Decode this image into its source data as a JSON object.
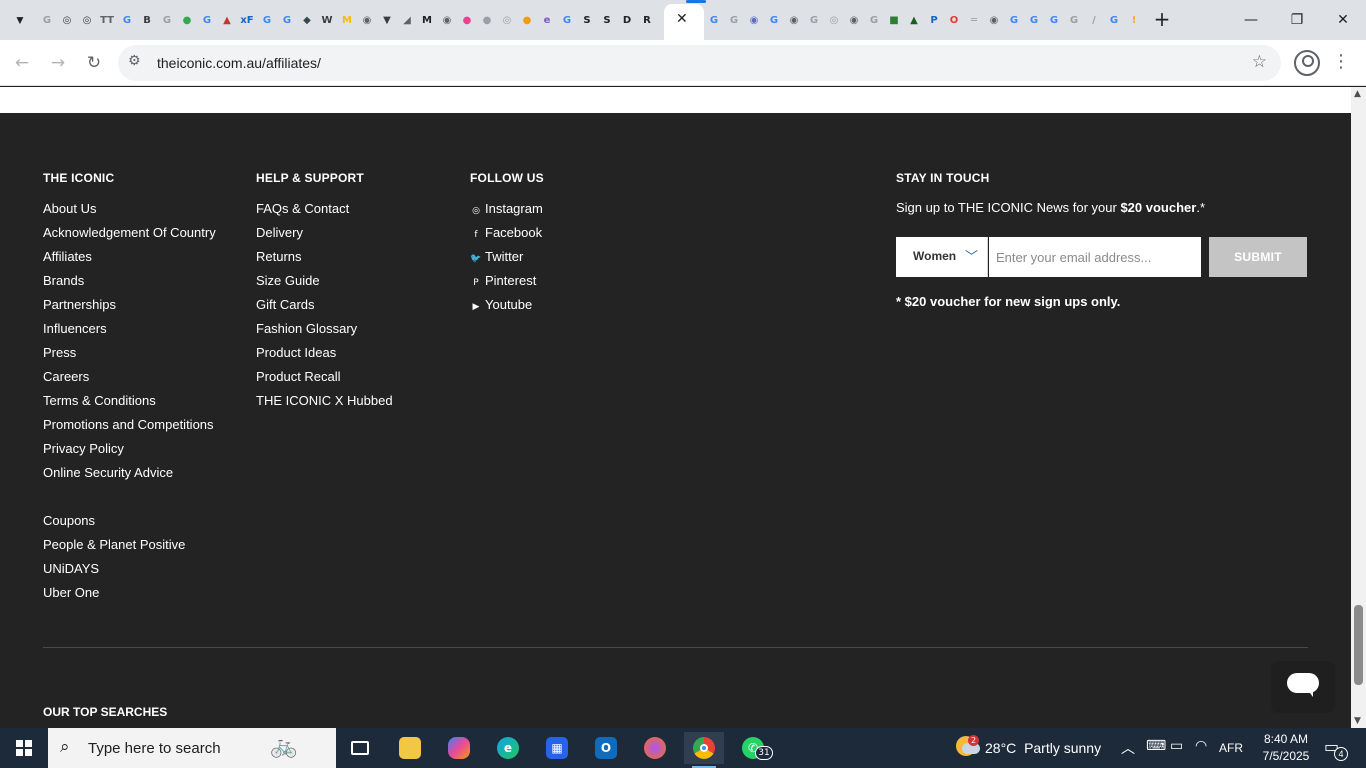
{
  "browser": {
    "url": "theiconic.com.au/affiliates/",
    "active_tab_close": "✕",
    "new_tab": "+",
    "tab_favicons": [
      {
        "glyph": "G",
        "color": "#9aa0a6"
      },
      {
        "glyph": "◎",
        "color": "#3c3c3c"
      },
      {
        "glyph": "◎",
        "color": "#3c3c3c"
      },
      {
        "glyph": "TT",
        "color": "#5f6368"
      },
      {
        "glyph": "G",
        "color": "#4285f4"
      },
      {
        "glyph": "B",
        "color": "#3c3c3c"
      },
      {
        "glyph": "G",
        "color": "#9aa0a6"
      },
      {
        "glyph": "●",
        "color": "#34a853"
      },
      {
        "glyph": "G",
        "color": "#4285f4"
      },
      {
        "glyph": "▲",
        "color": "#c0392b"
      },
      {
        "glyph": "xF",
        "color": "#1565c0"
      },
      {
        "glyph": "G",
        "color": "#4285f4"
      },
      {
        "glyph": "G",
        "color": "#4285f4"
      },
      {
        "glyph": "◆",
        "color": "#37474f"
      },
      {
        "glyph": "W",
        "color": "#3c3c3c"
      },
      {
        "glyph": "M",
        "color": "#fbbc04"
      },
      {
        "glyph": "◉",
        "color": "#5f6368"
      },
      {
        "glyph": "▼",
        "color": "#3c3c3c"
      },
      {
        "glyph": "◢",
        "color": "#5f6368"
      },
      {
        "glyph": "M",
        "color": "#202124"
      },
      {
        "glyph": "◉",
        "color": "#5f6368"
      },
      {
        "glyph": "●",
        "color": "#e84393"
      },
      {
        "glyph": "●",
        "color": "#9aa0a6"
      },
      {
        "glyph": "◎",
        "color": "#9aa0a6"
      },
      {
        "glyph": "●",
        "color": "#f39c12"
      },
      {
        "glyph": "e",
        "color": "#7e57c2"
      },
      {
        "glyph": "G",
        "color": "#4285f4"
      },
      {
        "glyph": "S",
        "color": "#202124"
      },
      {
        "glyph": "S",
        "color": "#202124"
      },
      {
        "glyph": "D",
        "color": "#202124"
      },
      {
        "glyph": "R",
        "color": "#202124"
      }
    ],
    "tab_favicons_right": [
      {
        "glyph": "G",
        "color": "#4285f4"
      },
      {
        "glyph": "G",
        "color": "#9aa0a6"
      },
      {
        "glyph": "◉",
        "color": "#5c6bc0"
      },
      {
        "glyph": "G",
        "color": "#4285f4"
      },
      {
        "glyph": "◉",
        "color": "#5f6368"
      },
      {
        "glyph": "G",
        "color": "#9aa0a6"
      },
      {
        "glyph": "◎",
        "color": "#9aa0a6"
      },
      {
        "glyph": "◉",
        "color": "#5f6368"
      },
      {
        "glyph": "G",
        "color": "#9aa0a6"
      },
      {
        "glyph": "■",
        "color": "#2e7d32"
      },
      {
        "glyph": "▲",
        "color": "#1b5e20"
      },
      {
        "glyph": "P",
        "color": "#1565c0"
      },
      {
        "glyph": "O",
        "color": "#e53935"
      },
      {
        "glyph": "═",
        "color": "#9aa0a6"
      },
      {
        "glyph": "◉",
        "color": "#5f6368"
      },
      {
        "glyph": "G",
        "color": "#4285f4"
      },
      {
        "glyph": "G",
        "color": "#4285f4"
      },
      {
        "glyph": "G",
        "color": "#4285f4"
      },
      {
        "glyph": "G",
        "color": "#9aa0a6"
      },
      {
        "glyph": "/",
        "color": "#9aa0a6"
      },
      {
        "glyph": "G",
        "color": "#4285f4"
      },
      {
        "glyph": "!",
        "color": "#f9a825"
      }
    ]
  },
  "footer": {
    "col1": {
      "title": "THE ICONIC",
      "links": [
        "About Us",
        "Acknowledgement Of Country",
        "Affiliates",
        "Brands",
        "Partnerships",
        "Influencers",
        "Press",
        "Careers",
        "Terms & Conditions",
        "Promotions and Competitions",
        "Privacy Policy",
        "Online Security Advice"
      ],
      "links2": [
        "Coupons",
        "People & Planet Positive",
        "UNiDAYS",
        "Uber One"
      ]
    },
    "col2": {
      "title": "HELP & SUPPORT",
      "links": [
        "FAQs & Contact",
        "Delivery",
        "Returns",
        "Size Guide",
        "Gift Cards",
        "Fashion Glossary",
        "Product Ideas",
        "Product Recall",
        "THE ICONIC X Hubbed"
      ]
    },
    "col3": {
      "title": "FOLLOW US",
      "links": [
        {
          "label": "Instagram",
          "icon": "instagram-icon",
          "glyph": "◎"
        },
        {
          "label": "Facebook",
          "icon": "facebook-icon",
          "glyph": "f"
        },
        {
          "label": "Twitter",
          "icon": "twitter-icon",
          "glyph": "🐦"
        },
        {
          "label": "Pinterest",
          "icon": "pinterest-icon",
          "glyph": "P"
        },
        {
          "label": "Youtube",
          "icon": "youtube-icon",
          "glyph": "▶"
        }
      ]
    },
    "newsletter": {
      "title": "STAY IN TOUCH",
      "signup_prefix": "Sign up to THE ICONIC News for your ",
      "signup_bold": "$20 voucher",
      "signup_suffix": ".*",
      "gender_value": "Women",
      "email_placeholder": "Enter your email address...",
      "submit_label": "SUBMIT",
      "note": "* $20 voucher for new sign ups only."
    },
    "top_searches_title": "OUR TOP SEARCHES"
  },
  "taskbar": {
    "search_placeholder": "Type here to search",
    "whatsapp_badge": "31",
    "weather": {
      "temp": "28°C",
      "condition": "Partly sunny",
      "badge": "2"
    },
    "language": "AFR",
    "time": "8:40 AM",
    "date": "7/5/2025",
    "notification_count": "4"
  }
}
